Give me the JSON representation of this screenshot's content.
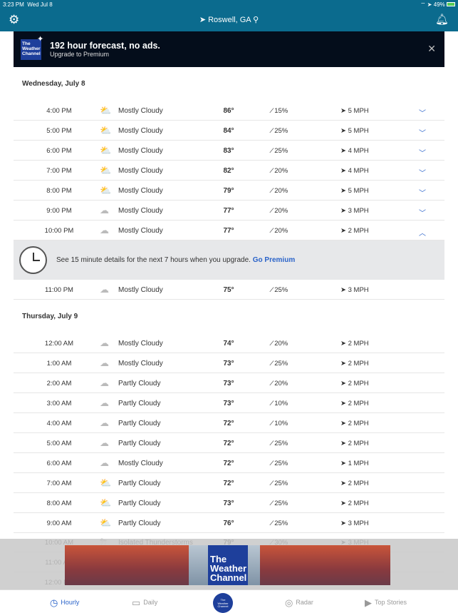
{
  "status": {
    "time": "3:23 PM",
    "date": "Wed Jul 8",
    "battery": "49%"
  },
  "nav": {
    "location": "Roswell, GA"
  },
  "banner": {
    "title": "192 hour forecast, no ads.",
    "subtitle": "Upgrade to Premium",
    "logo": "The Weather Channel"
  },
  "days": [
    {
      "label": "Wednesday, July 8",
      "rows": [
        {
          "time": "4:00 PM",
          "icon": "partly-sunny",
          "condition": "Mostly Cloudy",
          "temp": "86°",
          "precip": "15%",
          "wind": "5 MPH",
          "chevron": "down"
        },
        {
          "time": "5:00 PM",
          "icon": "partly-sunny",
          "condition": "Mostly Cloudy",
          "temp": "84°",
          "precip": "25%",
          "wind": "5 MPH",
          "chevron": "down"
        },
        {
          "time": "6:00 PM",
          "icon": "partly-sunny",
          "condition": "Mostly Cloudy",
          "temp": "83°",
          "precip": "25%",
          "wind": "4 MPH",
          "chevron": "down"
        },
        {
          "time": "7:00 PM",
          "icon": "partly-sunny",
          "condition": "Mostly Cloudy",
          "temp": "82°",
          "precip": "20%",
          "wind": "4 MPH",
          "chevron": "down"
        },
        {
          "time": "8:00 PM",
          "icon": "partly-sunny",
          "condition": "Mostly Cloudy",
          "temp": "79°",
          "precip": "20%",
          "wind": "5 MPH",
          "chevron": "down"
        },
        {
          "time": "9:00 PM",
          "icon": "cloudy-night",
          "condition": "Mostly Cloudy",
          "temp": "77°",
          "precip": "20%",
          "wind": "3 MPH",
          "chevron": "down"
        },
        {
          "time": "10:00 PM",
          "icon": "cloudy-night",
          "condition": "Mostly Cloudy",
          "temp": "77°",
          "precip": "20%",
          "wind": "2 MPH",
          "chevron": "up"
        },
        {
          "time": "11:00 PM",
          "icon": "cloudy-night",
          "condition": "Mostly Cloudy",
          "temp": "75°",
          "precip": "25%",
          "wind": "3 MPH",
          "chevron": ""
        }
      ]
    },
    {
      "label": "Thursday, July 9",
      "rows": [
        {
          "time": "12:00 AM",
          "icon": "cloudy-night",
          "condition": "Mostly Cloudy",
          "temp": "74°",
          "precip": "20%",
          "wind": "2 MPH",
          "chevron": ""
        },
        {
          "time": "1:00 AM",
          "icon": "cloudy-night",
          "condition": "Mostly Cloudy",
          "temp": "73°",
          "precip": "25%",
          "wind": "2 MPH",
          "chevron": ""
        },
        {
          "time": "2:00 AM",
          "icon": "partly-cloudy-night",
          "condition": "Partly Cloudy",
          "temp": "73°",
          "precip": "20%",
          "wind": "2 MPH",
          "chevron": ""
        },
        {
          "time": "3:00 AM",
          "icon": "partly-cloudy-night",
          "condition": "Partly Cloudy",
          "temp": "73°",
          "precip": "10%",
          "wind": "2 MPH",
          "chevron": ""
        },
        {
          "time": "4:00 AM",
          "icon": "partly-cloudy-night",
          "condition": "Partly Cloudy",
          "temp": "72°",
          "precip": "10%",
          "wind": "2 MPH",
          "chevron": ""
        },
        {
          "time": "5:00 AM",
          "icon": "partly-cloudy-night",
          "condition": "Partly Cloudy",
          "temp": "72°",
          "precip": "25%",
          "wind": "2 MPH",
          "chevron": ""
        },
        {
          "time": "6:00 AM",
          "icon": "cloudy-night",
          "condition": "Mostly Cloudy",
          "temp": "72°",
          "precip": "25%",
          "wind": "1 MPH",
          "chevron": ""
        },
        {
          "time": "7:00 AM",
          "icon": "partly-sunny",
          "condition": "Partly Cloudy",
          "temp": "72°",
          "precip": "25%",
          "wind": "2 MPH",
          "chevron": ""
        },
        {
          "time": "8:00 AM",
          "icon": "partly-sunny",
          "condition": "Partly Cloudy",
          "temp": "73°",
          "precip": "25%",
          "wind": "2 MPH",
          "chevron": ""
        },
        {
          "time": "9:00 AM",
          "icon": "partly-sunny",
          "condition": "Partly Cloudy",
          "temp": "76°",
          "precip": "25%",
          "wind": "3 MPH",
          "chevron": ""
        },
        {
          "time": "10:00 AM",
          "icon": "thunderstorm",
          "condition": "Isolated Thunderstorms",
          "temp": "79°",
          "precip": "30%",
          "wind": "3 MPH",
          "chevron": ""
        },
        {
          "time": "11:00 AM",
          "icon": "",
          "condition": "",
          "temp": "",
          "precip": "",
          "wind": "",
          "chevron": ""
        },
        {
          "time": "12:00 PM",
          "icon": "",
          "condition": "",
          "temp": "",
          "precip": "",
          "wind": "",
          "chevron": ""
        }
      ]
    }
  ],
  "promo": {
    "text": "See 15 minute details for the next 7 hours when you upgrade.",
    "link": "Go Premium"
  },
  "ad": {
    "logo": "The Weather Channel"
  },
  "tabs": [
    {
      "label": "Hourly",
      "icon": "clock-icon",
      "active": true
    },
    {
      "label": "Daily",
      "icon": "calendar-icon"
    },
    {
      "label": "Radar",
      "icon": "radar-icon"
    },
    {
      "label": "Top Stories",
      "icon": "play-icon"
    }
  ],
  "colors": {
    "header": "#0b6b8e",
    "accent": "#2a63c9",
    "banner": "#040d1b"
  }
}
